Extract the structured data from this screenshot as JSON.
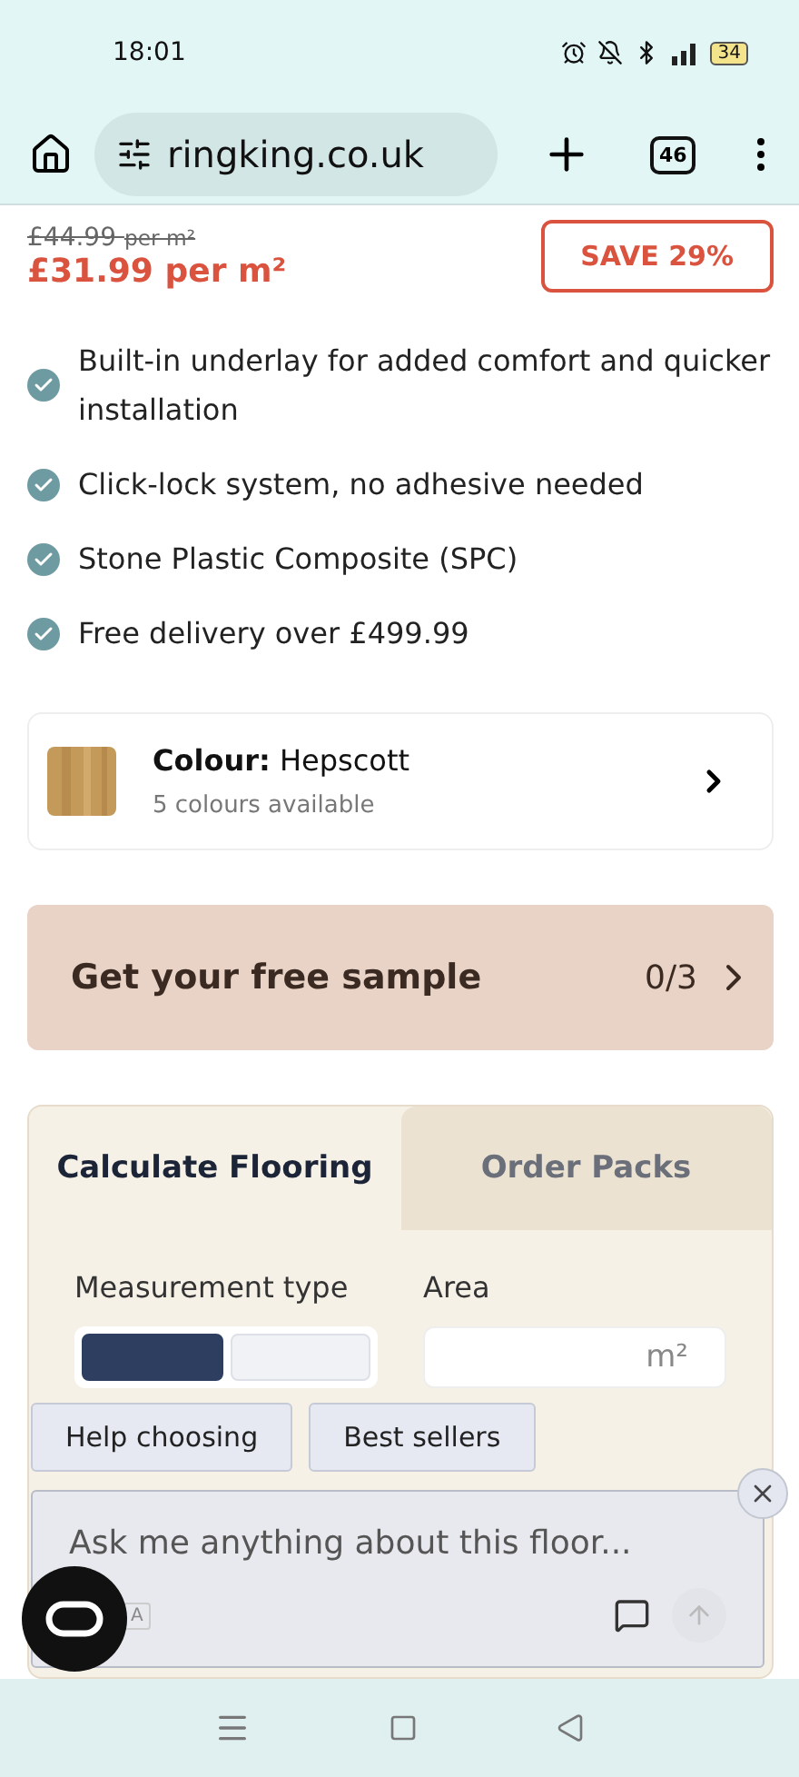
{
  "status_bar": {
    "time": "18:01",
    "battery": "34"
  },
  "browser": {
    "url": "ringking.co.uk",
    "tab_count": "46"
  },
  "price": {
    "was": "£44.99",
    "was_unit": "per m²",
    "now": "£31.99 per m²",
    "badge": "SAVE 29%"
  },
  "features": [
    "Built-in underlay for added comfort and quicker installation",
    "Click-lock system, no adhesive needed",
    "Stone Plastic Composite (SPC)",
    "Free delivery over £499.99"
  ],
  "colour": {
    "label": "Colour:",
    "name": "Hepscott",
    "note": "5 colours available"
  },
  "sample": {
    "label": "Get your free sample",
    "count": "0/3"
  },
  "calculator": {
    "tabs": [
      {
        "label": "Calculate Flooring",
        "selected": true
      },
      {
        "label": "Order Packs",
        "selected": false
      }
    ],
    "measurement_label": "Measurement type",
    "measurement_segments": [
      {
        "selected": true
      },
      {
        "selected": false
      }
    ],
    "area_label": "Area",
    "area_unit": "m²"
  },
  "chat": {
    "chips": [
      "Help choosing",
      "Best sellers"
    ],
    "placeholder": "Ask me anything about this floor...",
    "tag": "A"
  }
}
